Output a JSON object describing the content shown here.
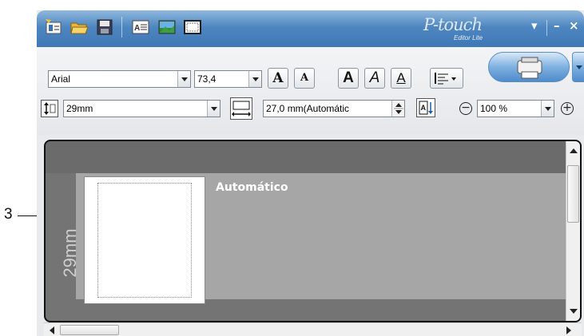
{
  "callout": {
    "number": "3"
  },
  "app": {
    "logo_name": "P-touch",
    "logo_sub": "Editor Lite"
  },
  "window_controls": {
    "dropdown": "▾",
    "minimize": "–",
    "close": "×"
  },
  "font": {
    "family": "Arial",
    "size": "73,4"
  },
  "label": {
    "width_value": "29mm",
    "length_value": "27,0 mm(Automátic",
    "zoom_value": "100 %",
    "canvas_mode_text": "Automático",
    "canvas_vertical_label": "29mm"
  },
  "toolbar_icons": {
    "row1": [
      "new-label-icon",
      "open-folder-icon",
      "save-icon",
      "text-icon",
      "image-icon",
      "frame-icon"
    ],
    "row2": [
      "font-size-up-icon",
      "font-size-down-icon",
      "bold-icon",
      "italic-icon",
      "underline-icon",
      "align-icon",
      "print-icon"
    ],
    "row3": [
      "label-width-icon",
      "label-length-icon",
      "vertical-text-icon",
      "zoom-out-icon",
      "zoom-in-icon"
    ]
  },
  "text_buttons": {
    "grow": "A",
    "shrink": "A",
    "bold": "A",
    "italic": "A",
    "underline": "A"
  },
  "colors": {
    "titlebar": "#4e86c0",
    "canvas_bg": "#747474",
    "label_band": "#a6a6a6",
    "accent": "#5a8ec5"
  }
}
